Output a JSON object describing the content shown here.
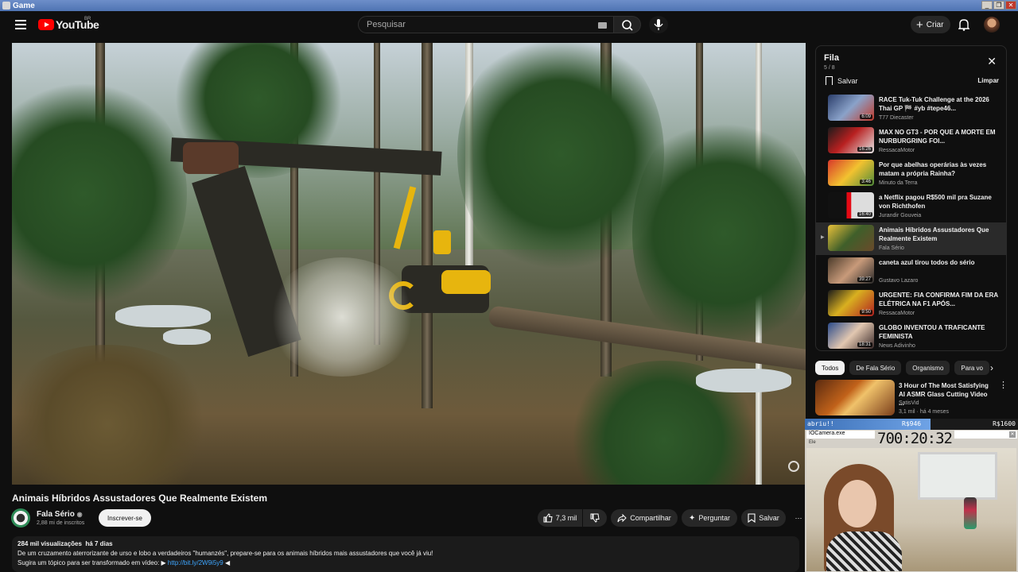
{
  "window": {
    "title": "Game"
  },
  "header": {
    "logo_text": "YouTube",
    "logo_country": "BR",
    "search_placeholder": "Pesquisar",
    "create_label": "Criar"
  },
  "video": {
    "title": "Animais Híbridos Assustadores Que Realmente Existem",
    "channel": "Fala Sério",
    "subscribers": "2,88 mi de inscritos",
    "subscribe_label": "Inscrever-se",
    "likes": "7,3 mil",
    "share_label": "Compartilhar",
    "ask_label": "Perguntar",
    "save_label": "Salvar"
  },
  "description": {
    "views": "284 mil visualizações",
    "age": "há 7 dias",
    "line1": "De um cruzamento aterrorizante de urso e lobo a verdadeiros \"humanzés\", prepare-se para os animais híbridos mais assustadores que você já viu!",
    "line2_prefix": "Sugira um tópico para ser transformado em vídeo: ▶",
    "link": "http://bit.ly/2W9i5y9",
    "line2_suffix": "◀"
  },
  "queue": {
    "title": "Fila",
    "count": "5 / 8",
    "save_label": "Salvar",
    "clear_label": "Limpar",
    "items": [
      {
        "title": "RACE Tuk-Tuk Challenge at the 2026 Thai GP 🏁 #yb #tepe46...",
        "channel": "T77 Diecaster",
        "duration": "6:09",
        "thumb": "linear-gradient(135deg,#2a3d6a,#8aa2c9 50%,#c23a2a)"
      },
      {
        "title": "MAX NO GT3 - POR QUE A MORTE EM NURBURGRING FOI...",
        "channel": "RessacaMotor",
        "duration": "16:26",
        "thumb": "linear-gradient(135deg,#1b1b1b,#b82020 45%,#e6e6e6)"
      },
      {
        "title": "Por que abelhas operárias às vezes matam a própria Rainha?",
        "channel": "Minuto da Terra",
        "duration": "3:46",
        "thumb": "linear-gradient(135deg,#d8382a,#f2c230 50%,#4e8a3a)"
      },
      {
        "title": "a Netflix pagou R$500 mil pra Suzane von Richthofen",
        "channel": "Jurandir Gouveia",
        "duration": "16:40",
        "thumb": "linear-gradient(90deg,#111 40%,#e50914 41%,#e50914 50%,#ddd 51%)"
      },
      {
        "title": "Animais Híbridos Assustadores Que Realmente Existem",
        "channel": "Fala Sério",
        "duration": "",
        "thumb": "linear-gradient(135deg,#e9c13a,#3f5f2a 50%,#6a4a2a)"
      },
      {
        "title": "caneta azul tirou todos do sério",
        "channel": "Gustavo Lazaro",
        "duration": "39:27",
        "thumb": "linear-gradient(135deg,#4a3a2a,#c89a7a 50%,#2a2a2a)"
      },
      {
        "title": "URGENTE: FIA CONFIRMA FIM DA ERA ELÉTRICA NA F1 APÓS...",
        "channel": "RessacaMotor",
        "duration": "9:50",
        "thumb": "linear-gradient(135deg,#1a1a1a,#d9b020 45%,#b02020)"
      },
      {
        "title": "GLOBO INVENTOU A TRAFICANTE FEMINISTA",
        "channel": "News Adivinho",
        "duration": "18:31",
        "thumb": "linear-gradient(135deg,#2a4a8a,#e2c7b0 50%,#3a2a2a)"
      }
    ]
  },
  "chips": [
    "Todos",
    "De Fala Sério",
    "Organismo",
    "Para vo"
  ],
  "recommendation": {
    "title": "3 Hour of The Most Satisfying AI ASMR Glass Cutting Video ...",
    "channel": "SatisVid",
    "meta": "3,1 mil · há 4 meses"
  },
  "overlay": {
    "label_left": "abriu!!",
    "label_mid": "R$946",
    "label_right": "R$1600",
    "progress_fraction": 0.59,
    "window_title": "IOCamera.exe",
    "clock": "700:20:32",
    "sub": "Ele"
  }
}
